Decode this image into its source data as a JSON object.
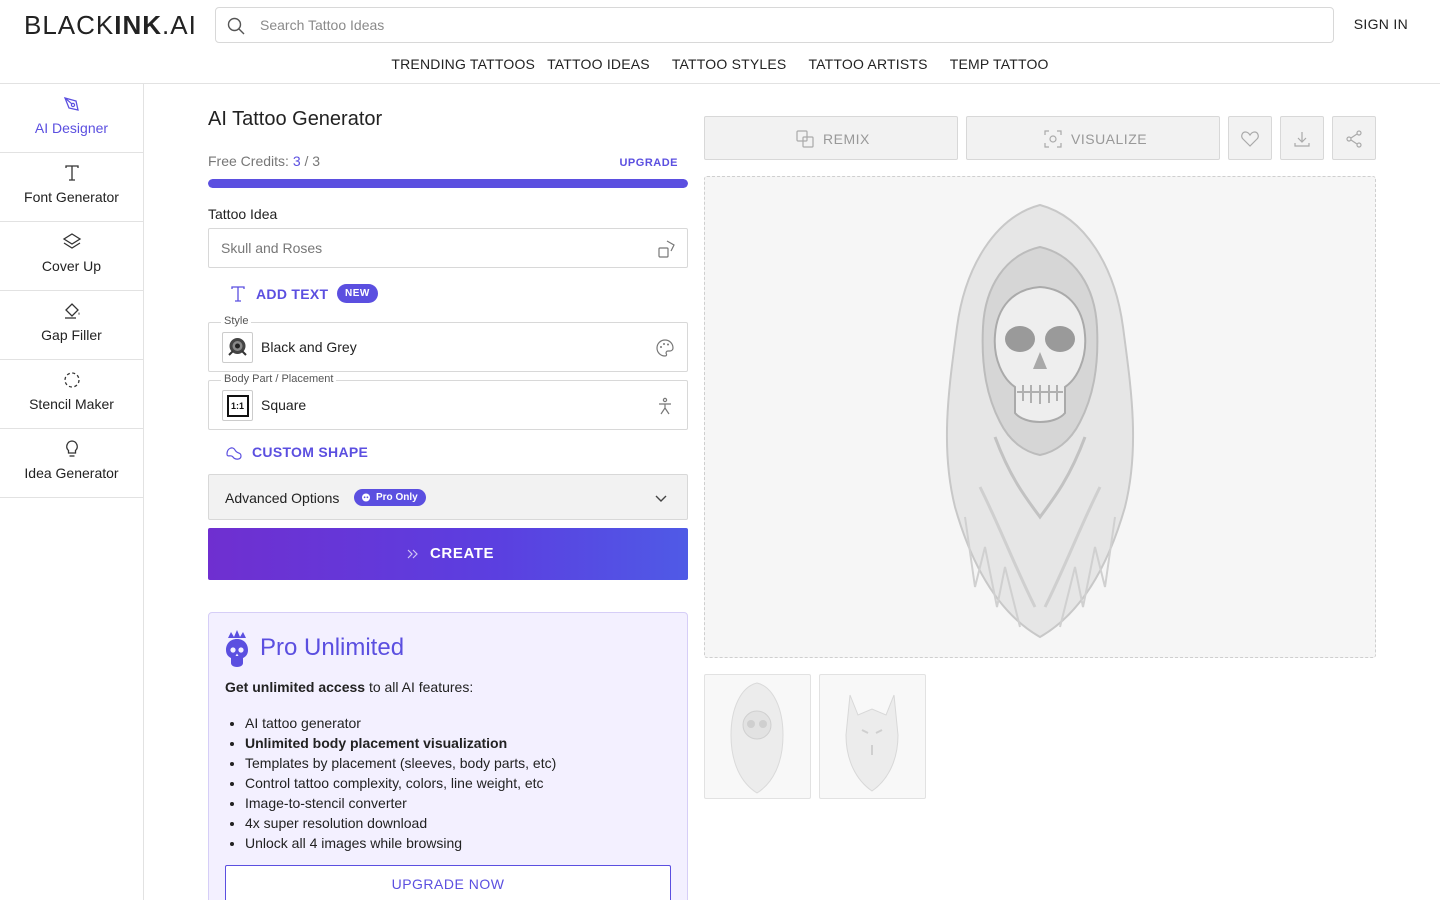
{
  "header": {
    "logo_thin": "BLACK",
    "logo_bold": "INK",
    "logo_suffix": ".AI",
    "search_placeholder": "Search Tattoo Ideas",
    "signin": "SIGN IN",
    "nav": [
      "TRENDING TATTOOS",
      "TATTOO IDEAS",
      "TATTOO STYLES",
      "TATTOO ARTISTS",
      "TEMP TATTOO"
    ]
  },
  "sidebar": {
    "items": [
      {
        "label": "AI Designer",
        "icon": "pen-nib-icon",
        "active": true
      },
      {
        "label": "Font Generator",
        "icon": "text-t-icon",
        "active": false
      },
      {
        "label": "Cover Up",
        "icon": "layers-icon",
        "active": false
      },
      {
        "label": "Gap Filler",
        "icon": "paint-bucket-icon",
        "active": false
      },
      {
        "label": "Stencil Maker",
        "icon": "dashed-circle-icon",
        "active": false
      },
      {
        "label": "Idea Generator",
        "icon": "lightbulb-icon",
        "active": false
      }
    ]
  },
  "form": {
    "title": "AI Tattoo Generator",
    "credits_label": "Free Credits:",
    "credits_used": "3",
    "credits_sep": "/ 3",
    "credits_fraction": 1.0,
    "upgrade": "UPGRADE",
    "idea_label": "Tattoo Idea",
    "idea_value": "Skull and Roses",
    "add_text": "ADD TEXT",
    "new_badge": "NEW",
    "style_legend": "Style",
    "style_value": "Black and Grey",
    "placement_legend": "Body Part / Placement",
    "placement_value": "Square",
    "placement_thumb": "1:1",
    "custom_shape": "CUSTOM SHAPE",
    "advanced": "Advanced Options",
    "pro_only": "Pro Only",
    "create": "CREATE"
  },
  "pro_card": {
    "title": "Pro Unlimited",
    "desc_bold": "Get unlimited access",
    "desc_rest": " to all AI features:",
    "features": [
      {
        "text": "AI tattoo generator",
        "bold": false
      },
      {
        "text": "Unlimited body placement visualization",
        "bold": true
      },
      {
        "text": "Templates by placement (sleeves, body parts, etc)",
        "bold": false
      },
      {
        "text": "Control tattoo complexity, colors, line weight, etc",
        "bold": false
      },
      {
        "text": "Image-to-stencil converter",
        "bold": false
      },
      {
        "text": "4x super resolution download",
        "bold": false
      },
      {
        "text": "Unlock all 4 images while browsing",
        "bold": false
      }
    ],
    "button": "UPGRADE NOW"
  },
  "result": {
    "remix": "REMIX",
    "visualize": "VISUALIZE"
  },
  "colors": {
    "accent": "#5b4fe0",
    "border": "#d8d8d8"
  }
}
